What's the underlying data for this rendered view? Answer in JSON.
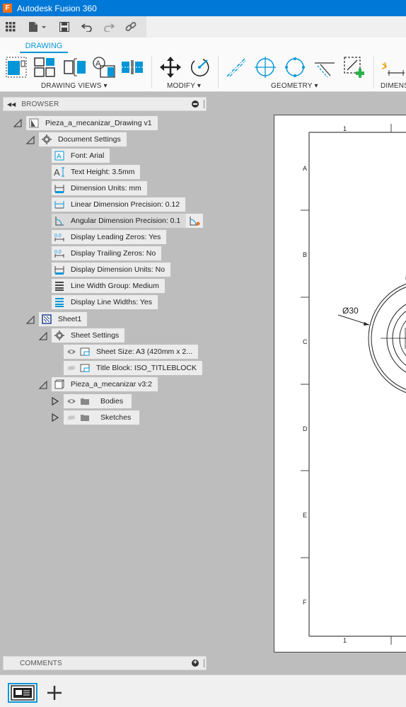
{
  "app": {
    "title": "Autodesk Fusion 360",
    "logo_letter": "F"
  },
  "ribbon": {
    "active_tab": "DRAWING",
    "groups": [
      {
        "label": "DRAWING VIEWS ▾"
      },
      {
        "label": "MODIFY ▾"
      },
      {
        "label": "GEOMETRY ▾"
      },
      {
        "label": "DIMENS"
      }
    ]
  },
  "browser": {
    "title": "BROWSER",
    "root": "Pieza_a_mecanizar_Drawing v1",
    "document_settings": "Document Settings",
    "settings": [
      "Font: Arial",
      "Text Height: 3.5mm",
      "Dimension Units: mm",
      "Linear Dimension Precision: 0.12",
      "Angular Dimension Precision: 0.1",
      "Display Leading Zeros: Yes",
      "Display Trailing Zeros: No",
      "Display Dimension Units: No",
      "Line Width Group: Medium",
      "Display Line Widths: Yes"
    ],
    "sheet": "Sheet1",
    "sheet_settings": "Sheet Settings",
    "sheet_size": "Sheet Size: A3 (420mm x 2...",
    "title_block": "Title Block: ISO_TITLEBLOCK",
    "component": "Pieza_a_mecanizar v3:2",
    "bodies": "Bodies",
    "sketches": "Sketches"
  },
  "comments": {
    "title": "COMMENTS"
  },
  "drawing": {
    "rows": [
      "A",
      "B",
      "C",
      "D",
      "E",
      "F"
    ],
    "col_top": "1",
    "col_bottom": "1",
    "dimension": "Ø30"
  },
  "colors": {
    "accent": "#0696d7",
    "titlebar": "#0078d7",
    "add_green": "#2bb24c"
  }
}
